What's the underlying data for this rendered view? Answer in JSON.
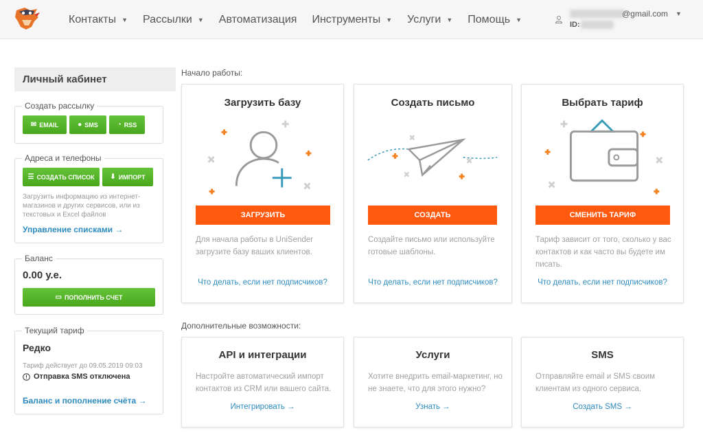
{
  "header": {
    "nav": [
      {
        "label": "Контакты",
        "dropdown": true
      },
      {
        "label": "Рассылки",
        "dropdown": true
      },
      {
        "label": "Автоматизация",
        "dropdown": false
      },
      {
        "label": "Инструменты",
        "dropdown": true
      },
      {
        "label": "Услуги",
        "dropdown": true
      },
      {
        "label": "Помощь",
        "dropdown": true
      }
    ],
    "account_email_suffix": "@gmail.com",
    "account_id_label": "ID:"
  },
  "sidebar": {
    "title": "Личный кабинет",
    "create_mailing": {
      "legend": "Создать рассылку",
      "email_btn": "EMAIL",
      "sms_btn": "SMS",
      "rss_btn": "RSS"
    },
    "contacts": {
      "legend": "Адреса и телефоны",
      "create_list_btn": "СОЗДАТЬ СПИСОК",
      "import_btn": "ИМПОРТ",
      "hint": "Загрузить информацию из интернет-магазинов и других сервисов, или из текстовых и Excel файлов",
      "manage_link": "Управление списками →"
    },
    "balance": {
      "legend": "Баланс",
      "value": "0.00 у.е.",
      "topup_btn": "ПОПОЛНИТЬ СЧЕТ"
    },
    "tariff": {
      "legend": "Текущий тариф",
      "name": "Редко",
      "valid_until": "Тариф действует до 09.05.2019 09:03",
      "sms_status": "Отправка SMS отключена",
      "link": "Баланс и пополнение счёта →"
    }
  },
  "main": {
    "start_label": "Начало работы:",
    "extra_label": "Дополнительные возможности:",
    "start_cards": [
      {
        "title": "Загрузить базу",
        "button": "ЗАГРУЗИТЬ",
        "desc": "Для начала работы в UniSender загрузите базу ваших клиентов.",
        "link": "Что делать, если нет подписчиков?"
      },
      {
        "title": "Создать письмо",
        "button": "СОЗДАТЬ",
        "desc": "Создайте письмо или используйте готовые шаблоны.",
        "link": "Что делать, если нет подписчиков?"
      },
      {
        "title": "Выбрать тариф",
        "button": "СМЕНИТЬ ТАРИФ",
        "desc": "Тариф зависит от того, сколько у вас контактов и как часто вы будете им писать.",
        "link": "Что делать, если нет подписчиков?"
      }
    ],
    "extra_cards": [
      {
        "title": "API и интеграции",
        "desc": "Настройте автоматический импорт контактов из CRM или вашего сайта.",
        "link": "Интегрировать →"
      },
      {
        "title": "Услуги",
        "desc": "Хотите внедрить email-маркетинг, но не знаете, что для этого нужно?",
        "link": "Узнать →"
      },
      {
        "title": "SMS",
        "desc": "Отправляйте email и SMS своим клиентам из одного сервиса.",
        "link": "Создать SMS →"
      }
    ]
  },
  "colors": {
    "accent_orange": "#ff5a10",
    "green": "#56b52a",
    "link_blue": "#2e8bbf"
  }
}
